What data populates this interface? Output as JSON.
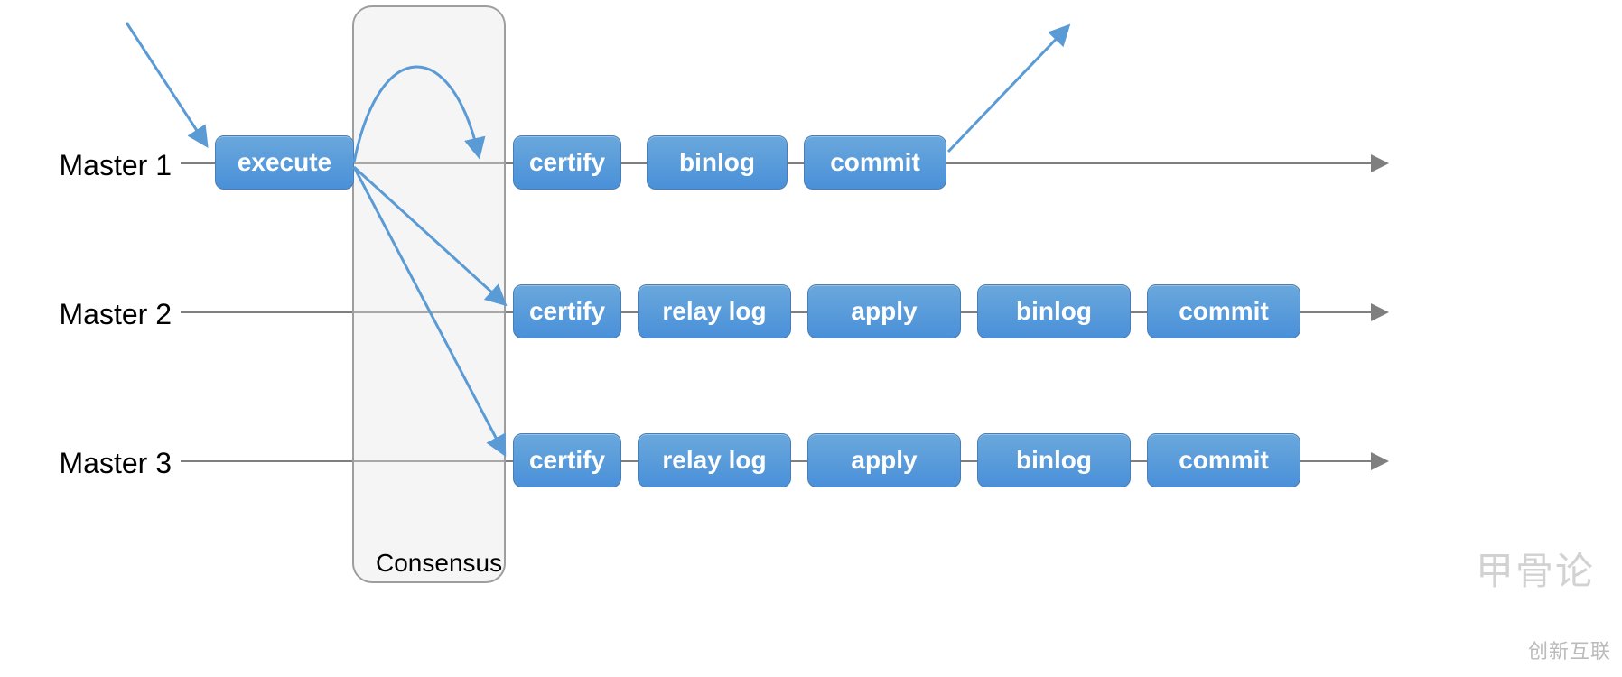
{
  "lanes": {
    "master1": "Master 1",
    "master2": "Master 2",
    "master3": "Master 3"
  },
  "boxes": {
    "m1_execute": "execute",
    "m1_certify": "certify",
    "m1_binlog": "binlog",
    "m1_commit": "commit",
    "m2_certify": "certify",
    "m2_relaylog": "relay log",
    "m2_apply": "apply",
    "m2_binlog": "binlog",
    "m2_commit": "commit",
    "m3_certify": "certify",
    "m3_relaylog": "relay log",
    "m3_apply": "apply",
    "m3_binlog": "binlog",
    "m3_commit": "commit"
  },
  "consensus": {
    "label": "Consensus"
  },
  "watermarks": {
    "w1": "甲骨论",
    "w2": "创新互联"
  },
  "colors": {
    "box_fill_top": "#6aa8dc",
    "box_fill_bottom": "#4a90d9",
    "box_border": "#4a7db3",
    "lane_line": "#7f7f7f",
    "arrow_blue": "#5b9bd5"
  }
}
